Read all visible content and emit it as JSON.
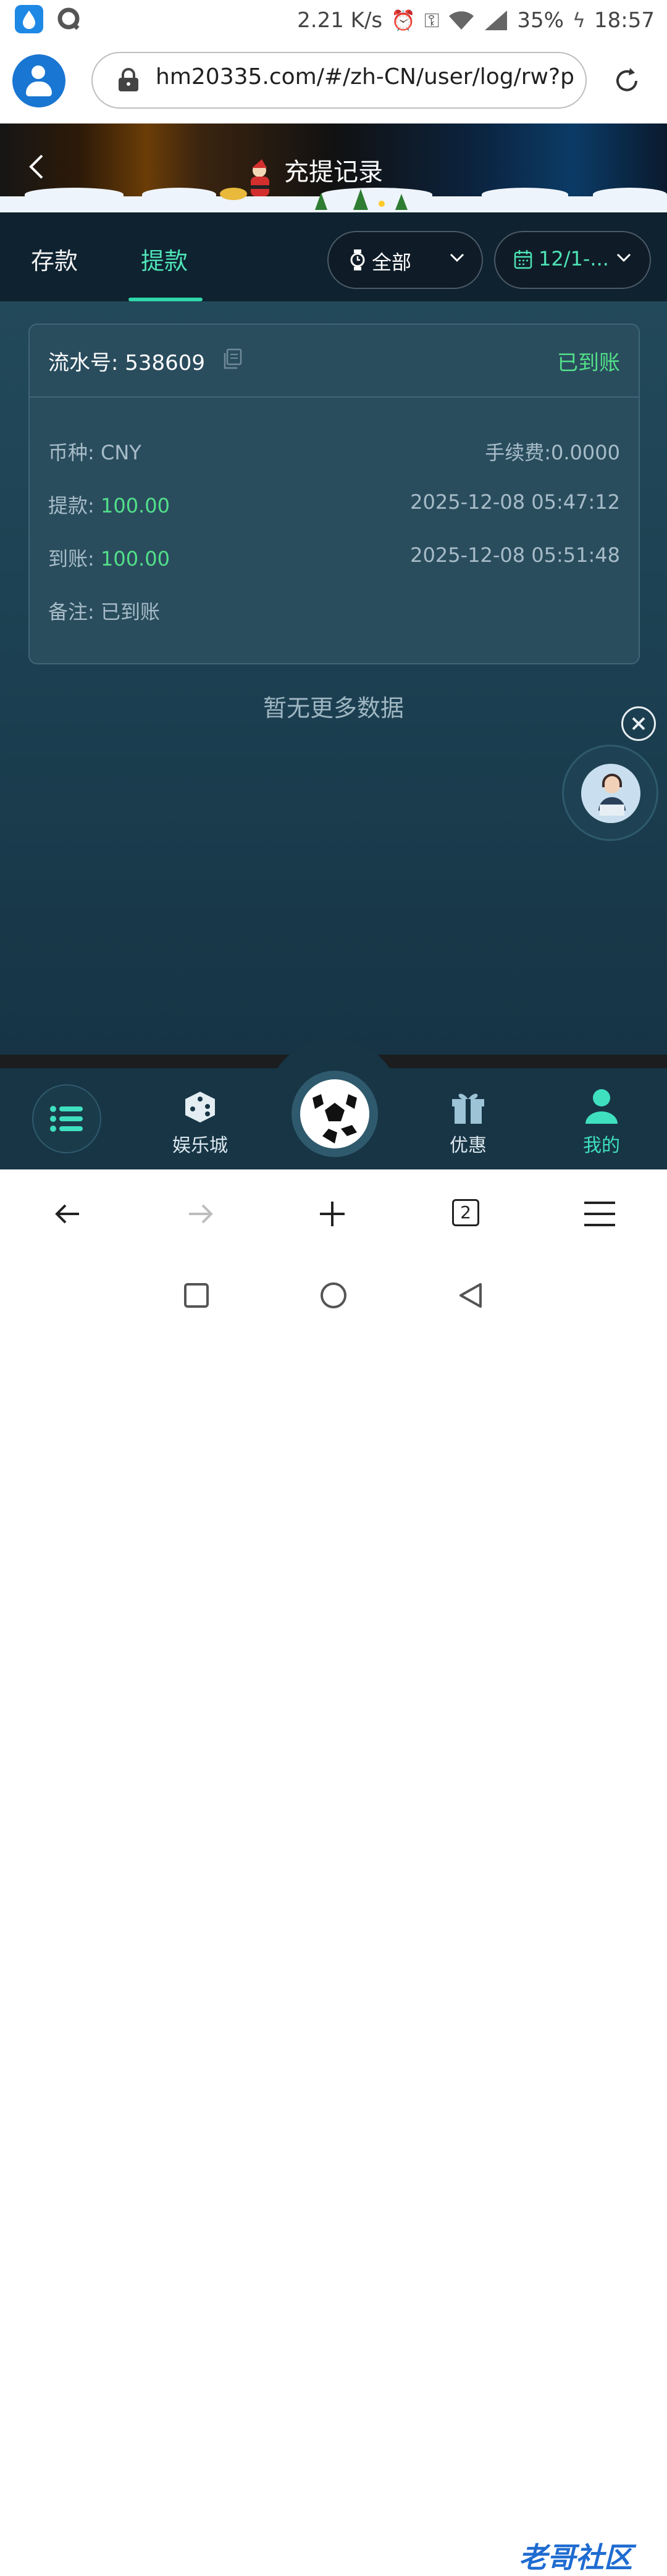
{
  "status_bar": {
    "speed": "2.21 K/s",
    "battery": "35%",
    "time": "18:57"
  },
  "browser": {
    "url": "hm20335.com/#/zh-CN/user/log/rw?pag",
    "tab_count": "2"
  },
  "header": {
    "title": "充提记录"
  },
  "tabs": [
    {
      "label": "存款",
      "active": false
    },
    {
      "label": "提款",
      "active": true
    }
  ],
  "filters": {
    "type": "全部",
    "date": "12/1-..."
  },
  "record": {
    "serial_label": "流水号: ",
    "serial_value": "538609",
    "status": "已到账",
    "currency_label": "币种: ",
    "currency_value": "CNY",
    "fee": "手续费:0.0000",
    "withdraw_label": "提款: ",
    "withdraw_amount": "100.00",
    "withdraw_time": "2025-12-08 05:47:12",
    "arrive_label": "到账: ",
    "arrive_amount": "100.00",
    "arrive_time": "2025-12-08 05:51:48",
    "note_label": "备注: ",
    "note_value": "已到账"
  },
  "no_more": "暂无更多数据",
  "bottom_nav": {
    "casino": "娱乐城",
    "promo": "优惠",
    "mine": "我的"
  },
  "watermark": "老哥社区",
  "colors": {
    "accent_green": "#52e089",
    "tab_active": "#4fe3b6",
    "background": "#1c4152"
  }
}
